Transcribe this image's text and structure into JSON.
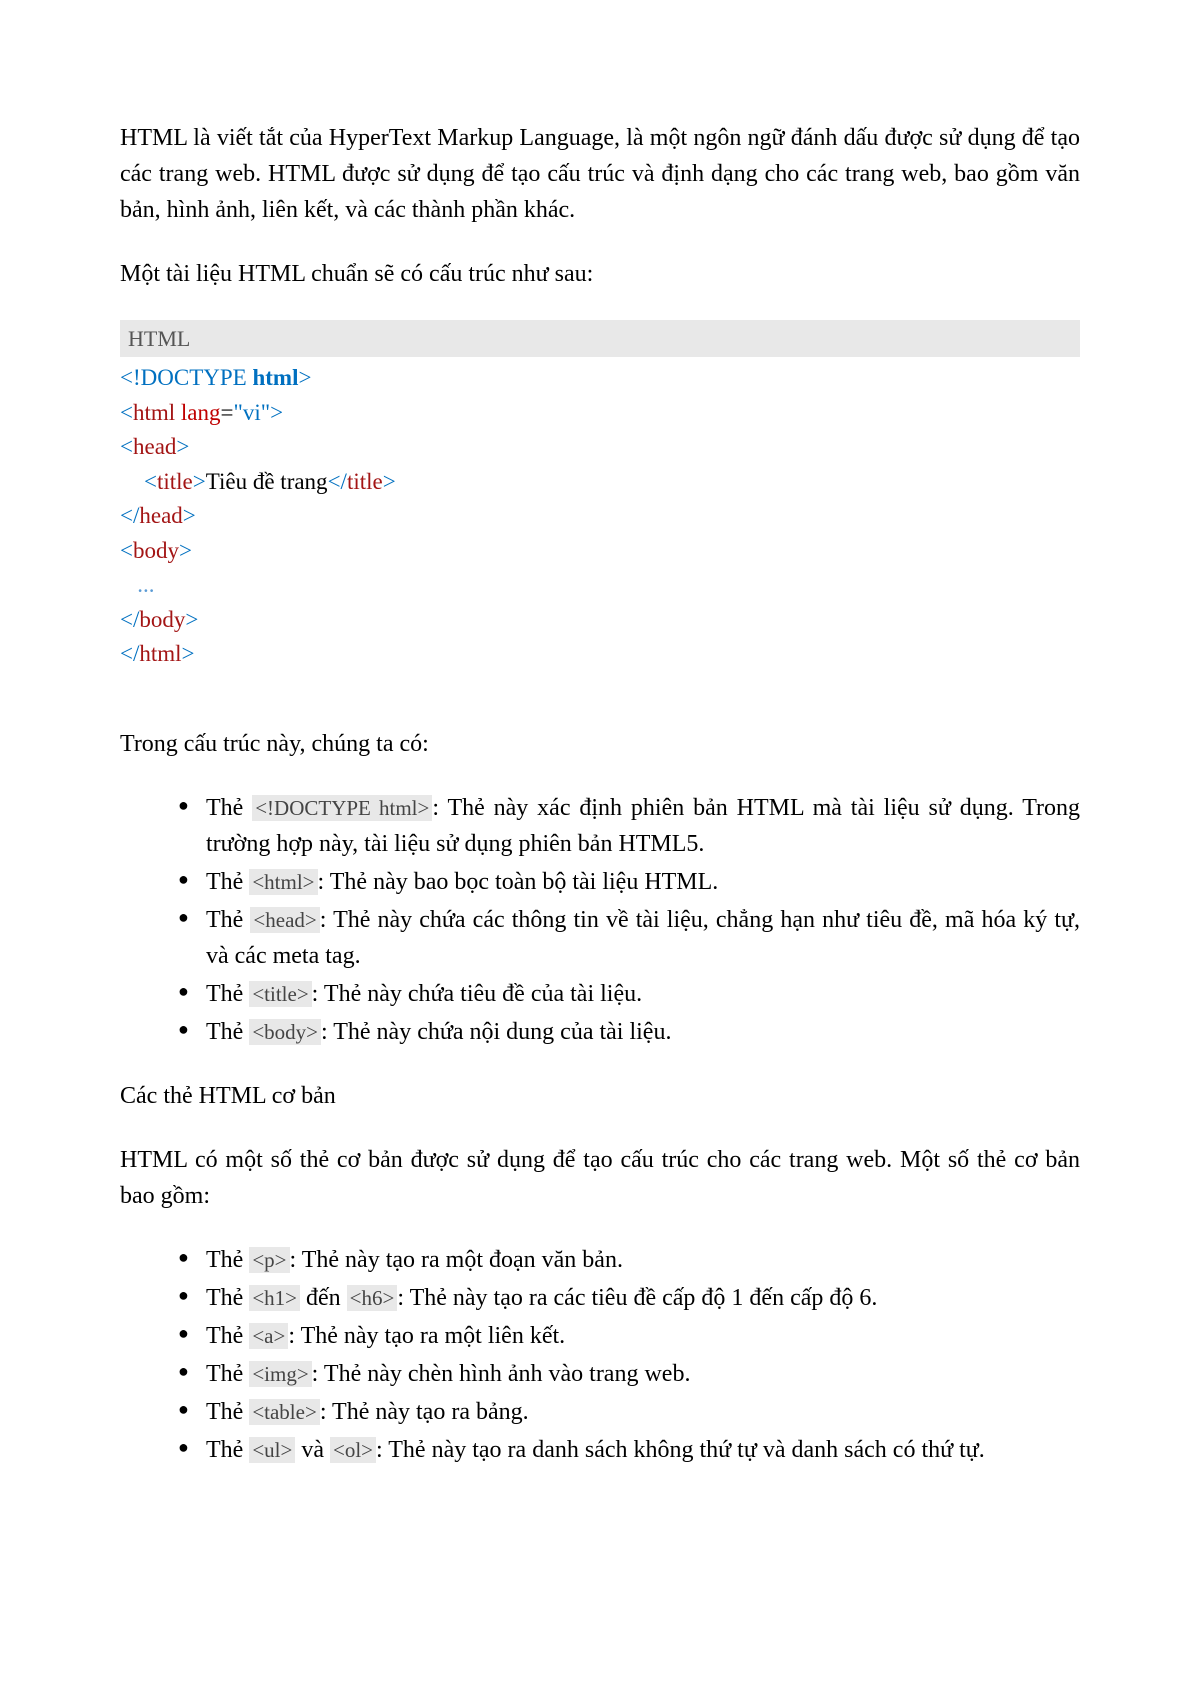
{
  "intro": "HTML là viết tắt của HyperText Markup Language, là một ngôn ngữ đánh dấu được sử dụng để tạo các trang web. HTML được sử dụng để tạo cấu trúc và định dạng cho các trang web, bao gồm văn bản, hình ảnh, liên kết, và các thành phần khác.",
  "struct_intro": "Một tài liệu HTML chuẩn sẽ có cấu trúc như sau:",
  "code": {
    "header": "HTML",
    "doctype_open": "<!DOCTYPE ",
    "doctype_html": "html",
    "doctype_close": ">",
    "html_open_lt": "<",
    "html_tag": "html",
    "lang_attr": " lang",
    "lang_eq": "=",
    "lang_val": "\"vi\"",
    "gt": ">",
    "head_open": "<",
    "head_tag": "head",
    "title_open": "<",
    "title_tag": "title",
    "title_text": "Tiêu đề trang",
    "title_close_open": "</",
    "head_close_open": "</",
    "body_tag": "body",
    "body_open": "<",
    "body_close_open": "</",
    "ellipsis": "   ...",
    "html_close_open": "</"
  },
  "struct_explain_intro": "Trong cấu trúc này, chúng ta có:",
  "struct_items": [
    {
      "pre": "Thẻ ",
      "code": "<!DOCTYPE html>",
      "post": ": Thẻ này xác định phiên bản HTML mà tài liệu sử dụng. Trong trường hợp này, tài liệu sử dụng phiên bản HTML5."
    },
    {
      "pre": "Thẻ ",
      "code": "<html>",
      "post": ": Thẻ này bao bọc toàn bộ tài liệu HTML."
    },
    {
      "pre": "Thẻ ",
      "code": "<head>",
      "post": ": Thẻ này chứa các thông tin về tài liệu, chẳng hạn như tiêu đề, mã hóa ký tự, và các meta tag."
    },
    {
      "pre": "Thẻ ",
      "code": "<title>",
      "post": ": Thẻ này chứa tiêu đề của tài liệu."
    },
    {
      "pre": "Thẻ ",
      "code": "<body>",
      "post": ": Thẻ này chứa nội dung của tài liệu."
    }
  ],
  "basic_title": "Các thẻ HTML cơ bản",
  "basic_intro": "HTML có một số thẻ cơ bản được sử dụng để tạo cấu trúc cho các trang web. Một số thẻ cơ bản bao gồm:",
  "basic_items": [
    {
      "pre": "Thẻ ",
      "code": "<p>",
      "post": ": Thẻ này tạo ra một đoạn văn bản."
    },
    {
      "pre": "Thẻ ",
      "code": "<h1>",
      "mid": " đến ",
      "code2": "<h6>",
      "post": ": Thẻ này tạo ra các tiêu đề cấp độ 1 đến cấp độ 6."
    },
    {
      "pre": "Thẻ ",
      "code": "<a>",
      "post": ": Thẻ này tạo ra một liên kết."
    },
    {
      "pre": "Thẻ ",
      "code": "<img>",
      "post": ": Thẻ này chèn hình ảnh vào trang web."
    },
    {
      "pre": "Thẻ ",
      "code": "<table>",
      "post": ": Thẻ này tạo ra bảng."
    },
    {
      "pre": "Thẻ ",
      "code": "<ul>",
      "mid": " và ",
      "code2": "<ol>",
      "post": ": Thẻ này tạo ra danh sách không thứ tự và danh sách có thứ tự."
    }
  ]
}
